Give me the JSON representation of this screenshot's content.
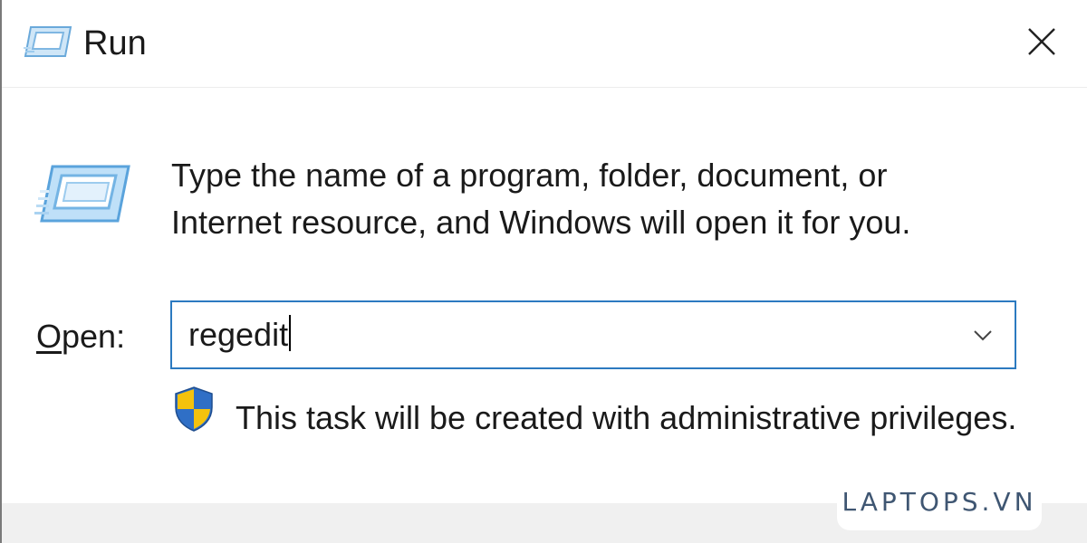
{
  "window": {
    "title": "Run",
    "title_icon": "run-icon",
    "close_icon": "close-icon"
  },
  "dialog": {
    "icon": "run-icon",
    "description_line1": "Type the name of a program, folder, document, or",
    "description_line2": "Internet resource, and Windows will open it for you.",
    "open_label_mnemonic": "O",
    "open_label_rest": "pen:",
    "open_value": "regedit",
    "dropdown_icon": "chevron-down-icon",
    "admin_icon": "uac-shield-icon",
    "admin_notice": "This task will be created with administrative privileges."
  },
  "watermark": {
    "text": "LAPTOPS.VN"
  },
  "colors": {
    "input_border": "#2c7ac0",
    "shield_blue": "#2f6fc6",
    "shield_yellow": "#f4c20d",
    "footer": "#f0f0f0"
  }
}
